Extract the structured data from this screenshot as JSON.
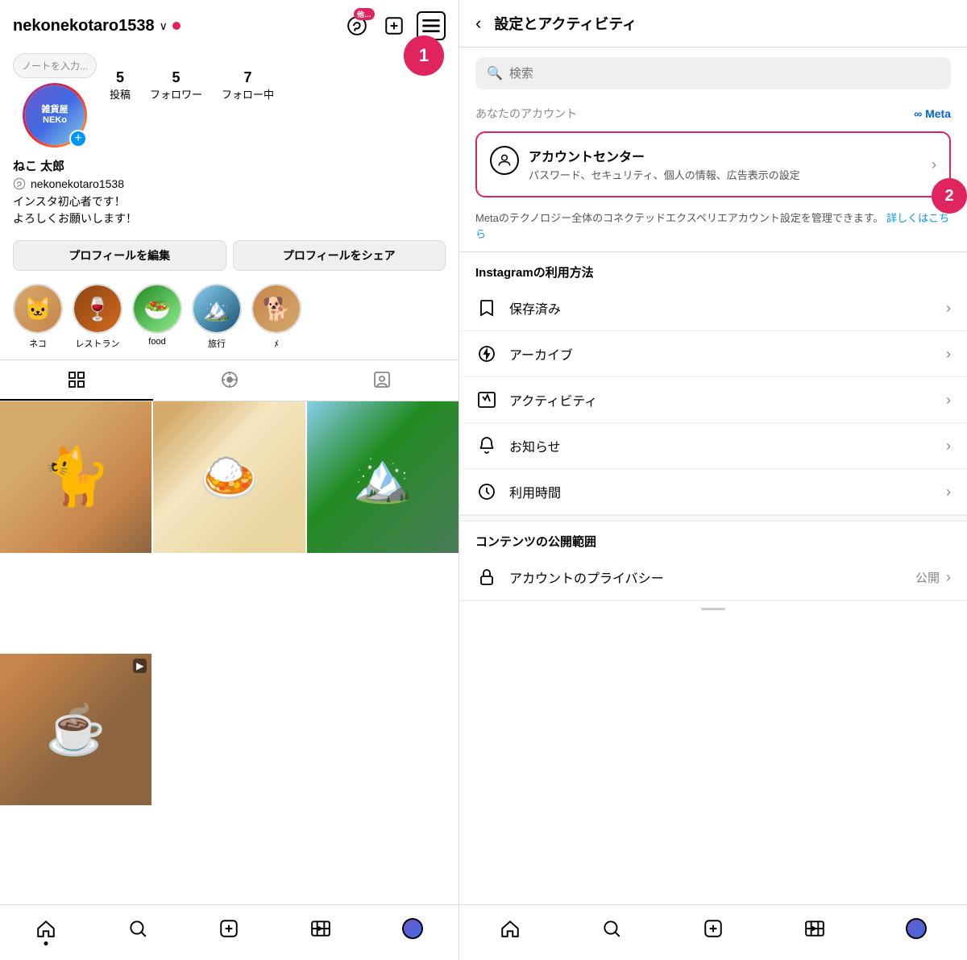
{
  "left": {
    "username": "nekonekotaro1538",
    "note_placeholder": "ノートを入力...",
    "avatar_text": "雑貨屋\nNEKo",
    "stats": [
      {
        "number": "5",
        "label": "投稿"
      },
      {
        "number": "5",
        "label": "フォロワー"
      },
      {
        "number": "7",
        "label": "フォロー中"
      }
    ],
    "display_name": "ねこ 太郎",
    "handle": "nekonekotaro1538",
    "bio_line1": "インスタ初心者です！",
    "bio_line2": "よろしくお願いします！",
    "edit_profile_btn": "プロフィールを編集",
    "share_profile_btn": "プロフィールをシェア",
    "highlights": [
      {
        "label": "ネコ",
        "color": "hl-neko"
      },
      {
        "label": "レストラン",
        "color": "hl-restaurant"
      },
      {
        "label": "food",
        "color": "hl-food"
      },
      {
        "label": "旅行",
        "color": "hl-travel"
      },
      {
        "label": "ﾒ",
        "color": "hl-more"
      }
    ],
    "badge_text": "他…",
    "circle_1_label": "1",
    "circle_2_label": "2",
    "grid_items": [
      {
        "type": "cat",
        "is_video": false
      },
      {
        "type": "food",
        "is_video": false
      },
      {
        "type": "nature",
        "is_video": false
      },
      {
        "type": "food2",
        "is_video": true
      },
      {
        "type": "food3",
        "is_video": false
      }
    ]
  },
  "right": {
    "back_label": "‹",
    "title": "設定とアクティビティ",
    "search_placeholder": "検索",
    "your_account_label": "あなたのアカウント",
    "meta_label": "∞ Meta",
    "account_center_title": "アカウントセンター",
    "account_center_subtitle": "パスワード、セキュリティ、個人の情報、広告表示の設定",
    "meta_description": "Metaのテクノロジー全体のコネクテッドエクスペリエアカウント設定を管理できます。",
    "meta_link_text": "詳しくはこちら",
    "instagram_usage_label": "Instagramの利用方法",
    "settings_items": [
      {
        "icon": "bookmark",
        "label": "保存済み",
        "value": ""
      },
      {
        "icon": "archive",
        "label": "アーカイブ",
        "value": ""
      },
      {
        "icon": "activity",
        "label": "アクティビティ",
        "value": ""
      },
      {
        "icon": "bell",
        "label": "お知らせ",
        "value": ""
      },
      {
        "icon": "clock",
        "label": "利用時間",
        "value": ""
      }
    ],
    "content_visibility_label": "コンテンツの公開範囲",
    "privacy_item": {
      "icon": "lock",
      "label": "アカウントのプライバシー",
      "value": "公開"
    }
  },
  "bottom_nav": {
    "items": [
      "home",
      "search",
      "add",
      "reels",
      "profile"
    ]
  }
}
